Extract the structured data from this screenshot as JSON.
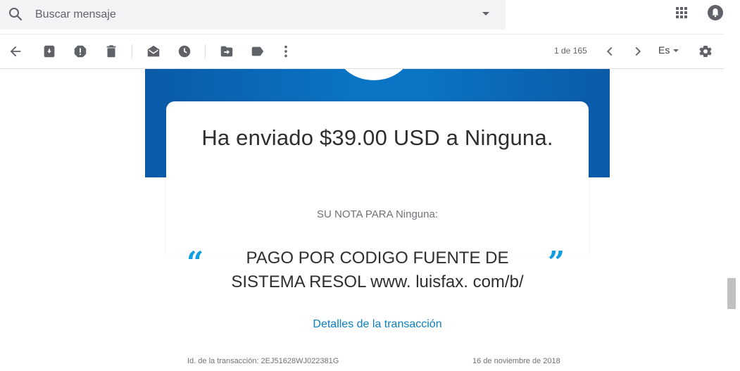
{
  "search": {
    "placeholder": "Buscar mensaje"
  },
  "header": {
    "icons": [
      "search-icon",
      "dropdown-icon",
      "apps-icon",
      "notifications-icon",
      "avatar"
    ]
  },
  "toolbar": {
    "icons": [
      "back-icon",
      "archive-icon",
      "report-spam-icon",
      "delete-icon",
      "mark-unread-icon",
      "snooze-icon",
      "move-to-icon",
      "label-icon",
      "more-icon",
      "prev-icon",
      "next-icon",
      "settings-icon"
    ],
    "count": "1 de 165",
    "language": "Es"
  },
  "email": {
    "headline": "Ha enviado $39.00 USD a Ninguna.",
    "note_label": "SU NOTA PARA Ninguna:",
    "quote_open": "“",
    "quote_close": "”",
    "note_text": "PAGO POR CODIGO FUENTE DE SISTEMA RESOL www. luisfax. com/b/",
    "details_link": "Detalles de la transacción",
    "transaction_id": "Id. de la transacción: 2EJ51628WJ022381G",
    "date": "16 de noviembre de 2018"
  },
  "colors": {
    "banner": "#0a74c5",
    "accent_quote": "#0e9ce3",
    "link": "#0a7fc4",
    "avatar": "#7b1fa2"
  }
}
